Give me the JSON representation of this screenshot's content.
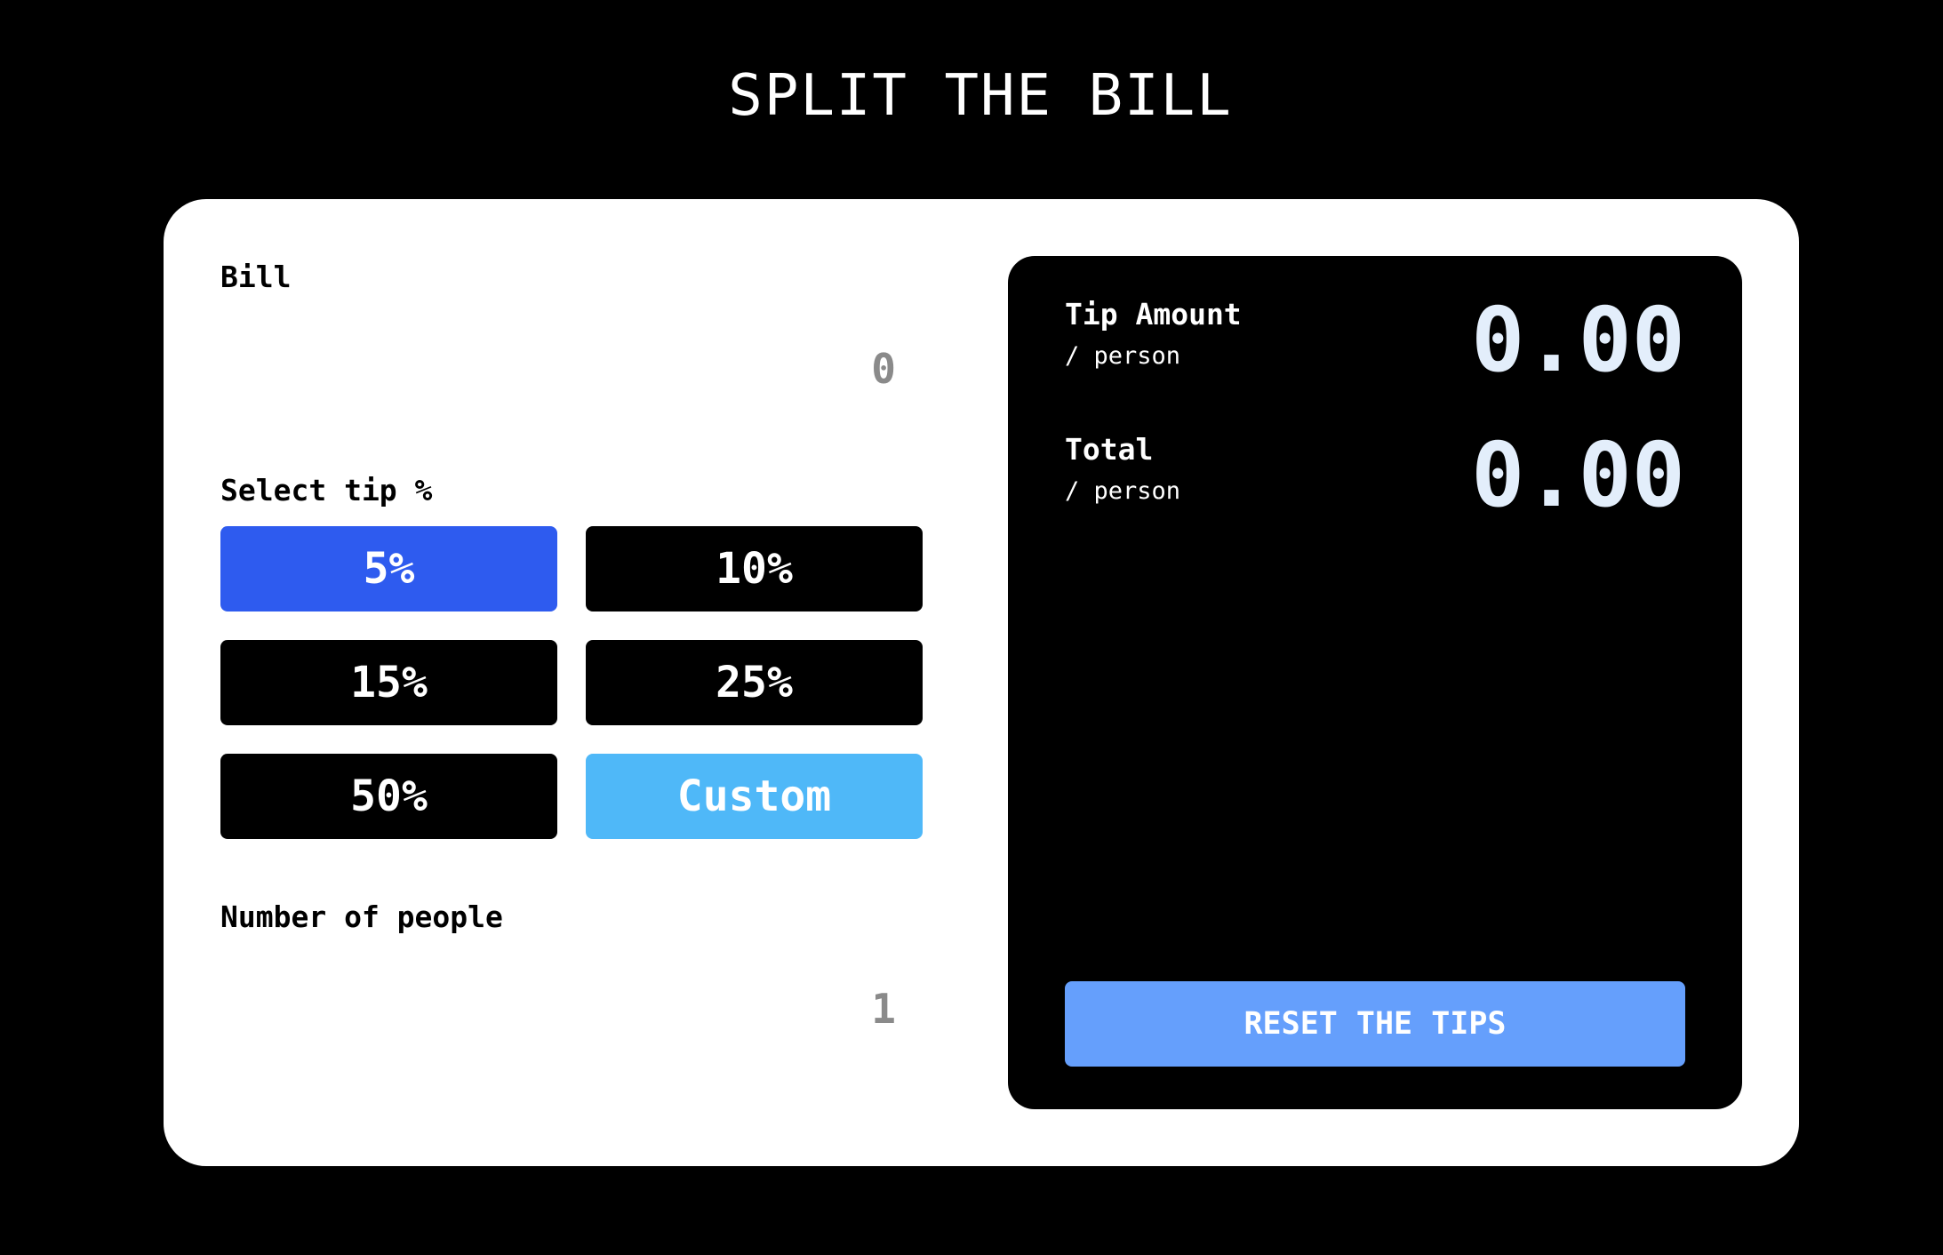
{
  "app": {
    "title": "SPLIT THE BILL"
  },
  "bill": {
    "label": "Bill",
    "placeholder": "0"
  },
  "tip": {
    "label": "Select tip %",
    "options": [
      {
        "label": "5%",
        "state": "selected"
      },
      {
        "label": "10%",
        "state": "default"
      },
      {
        "label": "15%",
        "state": "default"
      },
      {
        "label": "25%",
        "state": "default"
      },
      {
        "label": "50%",
        "state": "default"
      },
      {
        "label": "Custom",
        "state": "custom"
      }
    ]
  },
  "people": {
    "label": "Number of people",
    "placeholder": "1"
  },
  "results": {
    "tip_amount": {
      "label": "Tip Amount",
      "sub": "/ person",
      "value": "0.00"
    },
    "total": {
      "label": "Total",
      "sub": "/ person",
      "value": "0.00"
    },
    "reset_label": "RESET THE TIPS"
  },
  "colors": {
    "page_background": "#000000",
    "card_background": "#ffffff",
    "selected_tip": "#2e5bef",
    "custom_tip": "#4fb8f8",
    "reset_button": "#659ffc",
    "result_value": "#e3eefb"
  },
  "icons": []
}
